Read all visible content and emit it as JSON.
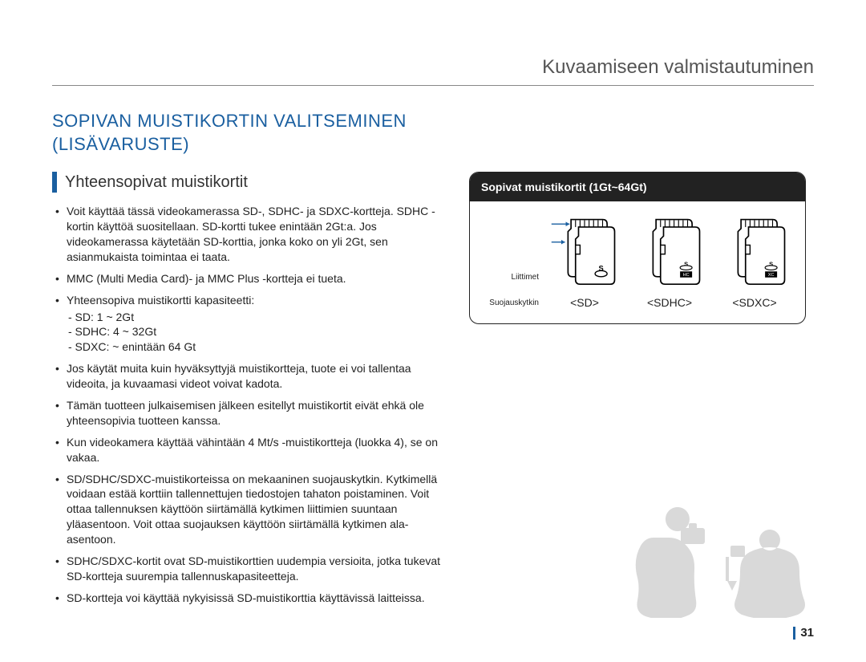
{
  "header": {
    "chapter_title": "Kuvaamiseen valmistautuminen"
  },
  "heading": {
    "line1": "SOPIVAN MUISTIKORTIN VALITSEMINEN",
    "line2": "(LISÄVARUSTE)"
  },
  "subheading": "Yhteensopivat muistikortit",
  "bullets": [
    {
      "text": "Voit käyttää tässä videokamerassa SD-, SDHC- ja SDXC-kortteja. SDHC -kortin käyttöä suositellaan. SD-kortti tukee enintään 2Gt:a. Jos videokamerassa käytetään SD-korttia, jonka koko on yli 2Gt, sen asianmukaista toimintaa ei taata."
    },
    {
      "text": "MMC (Multi Media Card)- ja MMC Plus -kortteja ei tueta."
    },
    {
      "text": "Yhteensopiva muistikortti kapasiteetti:",
      "sublines": [
        "- SD: 1 ~ 2Gt",
        "- SDHC: 4 ~ 32Gt",
        "- SDXC: ~ enintään 64 Gt"
      ]
    },
    {
      "text": "Jos käytät muita kuin hyväksyttyjä muistikortteja, tuote ei voi tallentaa videoita, ja kuvaamasi videot voivat kadota."
    },
    {
      "text": "Tämän tuotteen julkaisemisen jälkeen esitellyt muistikortit eivät ehkä ole yhteensopivia tuotteen kanssa."
    },
    {
      "text": "Kun videokamera käyttää vähintään 4 Mt/s -muistikortteja (luokka 4), se on vakaa."
    },
    {
      "text": "SD/SDHC/SDXC-muistikorteissa on mekaaninen suojauskytkin. Kytkimellä voidaan estää korttiin tallennettujen tiedostojen tahaton poistaminen. Voit ottaa tallennuksen käyttöön siirtämällä kytkimen liittimien suuntaan yläasentoon. Voit ottaa suojauksen käyttöön siirtämällä kytkimen ala-asentoon."
    },
    {
      "text": "SDHC/SDXC-kortit ovat SD-muistikorttien uudempia versioita, jotka tukevat SD-kortteja suurempia tallennuskapasiteetteja."
    },
    {
      "text": "SD-kortteja voi käyttää nykyisissä SD-muistikorttia käyttävissä laitteissa."
    }
  ],
  "card_box": {
    "title": "Sopivat muistikortit (1Gt~64Gt)",
    "label_terminals": "Liittimet",
    "label_switch": "Suojauskytkin",
    "cards": [
      {
        "caption": "<SD>",
        "logo": "SD"
      },
      {
        "caption": "<SDHC>",
        "logo": "SDHC"
      },
      {
        "caption": "<SDXC>",
        "logo": "SDXC"
      }
    ]
  },
  "page_number": "31"
}
